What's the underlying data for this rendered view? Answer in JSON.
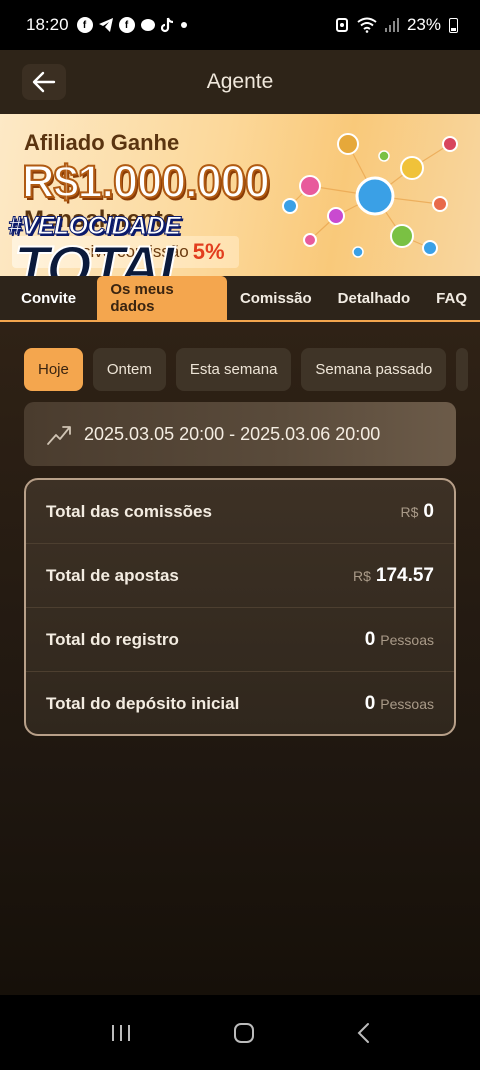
{
  "status_bar": {
    "time": "18:20",
    "battery": "23%",
    "notification_icons": [
      "facebook-icon",
      "telegram-icon",
      "facebook-icon",
      "messenger-icon",
      "tiktok-icon",
      "dot-icon"
    ]
  },
  "header": {
    "title": "Agente"
  },
  "banner": {
    "line1": "Afiliado Ganhe",
    "line2": "R$1.000.000",
    "line3": "Mensalmente",
    "line4": "sivo comissão",
    "line4_highlight": "5%"
  },
  "watermark": {
    "top": "#VELOCIDADE",
    "main": "TOTAL"
  },
  "tabs": [
    {
      "label": "Convite"
    },
    {
      "label": "Os meus dados",
      "active": true
    },
    {
      "label": "Comissão"
    },
    {
      "label": "Detalhado"
    },
    {
      "label": "FAQ"
    }
  ],
  "period_chips": [
    {
      "label": "Hoje",
      "active": true
    },
    {
      "label": "Ontem"
    },
    {
      "label": "Esta semana"
    },
    {
      "label": "Semana passado"
    }
  ],
  "date_range": {
    "text": "2025.03.05 20:00 - 2025.03.06 20:00"
  },
  "stats": [
    {
      "label": "Total das comissões",
      "currency": "R$",
      "value": "0"
    },
    {
      "label": "Total de apostas",
      "currency": "R$",
      "value": "174.57"
    },
    {
      "label": "Total do registro",
      "value": "0",
      "unit": "Pessoas"
    },
    {
      "label": "Total do depósito inicial",
      "value": "0",
      "unit": "Pessoas"
    }
  ],
  "colors": {
    "accent": "#f4a64e",
    "background": "#2b1f14",
    "panel_border": "#b8a089"
  }
}
